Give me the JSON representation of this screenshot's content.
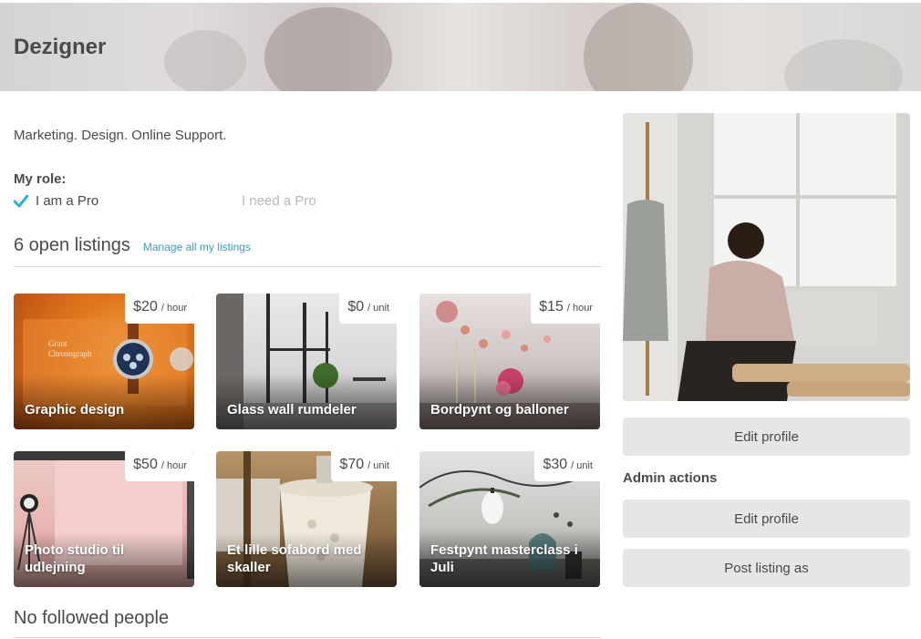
{
  "header": {
    "title": "Dezigner"
  },
  "profile": {
    "tagline": "Marketing. Design. Online Support.",
    "role_label": "My role:",
    "role_pro": "I am a Pro",
    "role_need": "I need a Pro"
  },
  "listings": {
    "title": "6 open listings",
    "manage_link": "Manage all my listings",
    "items": [
      {
        "name": "Graphic design",
        "price": "$20",
        "unit": "/ hour"
      },
      {
        "name": "Glass wall rumdeler",
        "price": "$0",
        "unit": "/ unit"
      },
      {
        "name": "Bordpynt og balloner",
        "price": "$15",
        "unit": "/ hour"
      },
      {
        "name": "Photo studio til udlejning",
        "price": "$50",
        "unit": "/ hour"
      },
      {
        "name": "Et lille sofabord med skaller",
        "price": "$70",
        "unit": "/ unit"
      },
      {
        "name": "Festpynt masterclass i Juli",
        "price": "$30",
        "unit": "/ unit"
      }
    ]
  },
  "followed": {
    "title": "No followed people"
  },
  "sidebar": {
    "edit_profile": "Edit profile",
    "admin_label": "Admin actions",
    "admin_edit_profile": "Edit profile",
    "post_listing_as": "Post listing as"
  },
  "colors": {
    "accent": "#3a9ec4",
    "check": "#2ab0d6",
    "button_bg": "#e6e6e6"
  }
}
